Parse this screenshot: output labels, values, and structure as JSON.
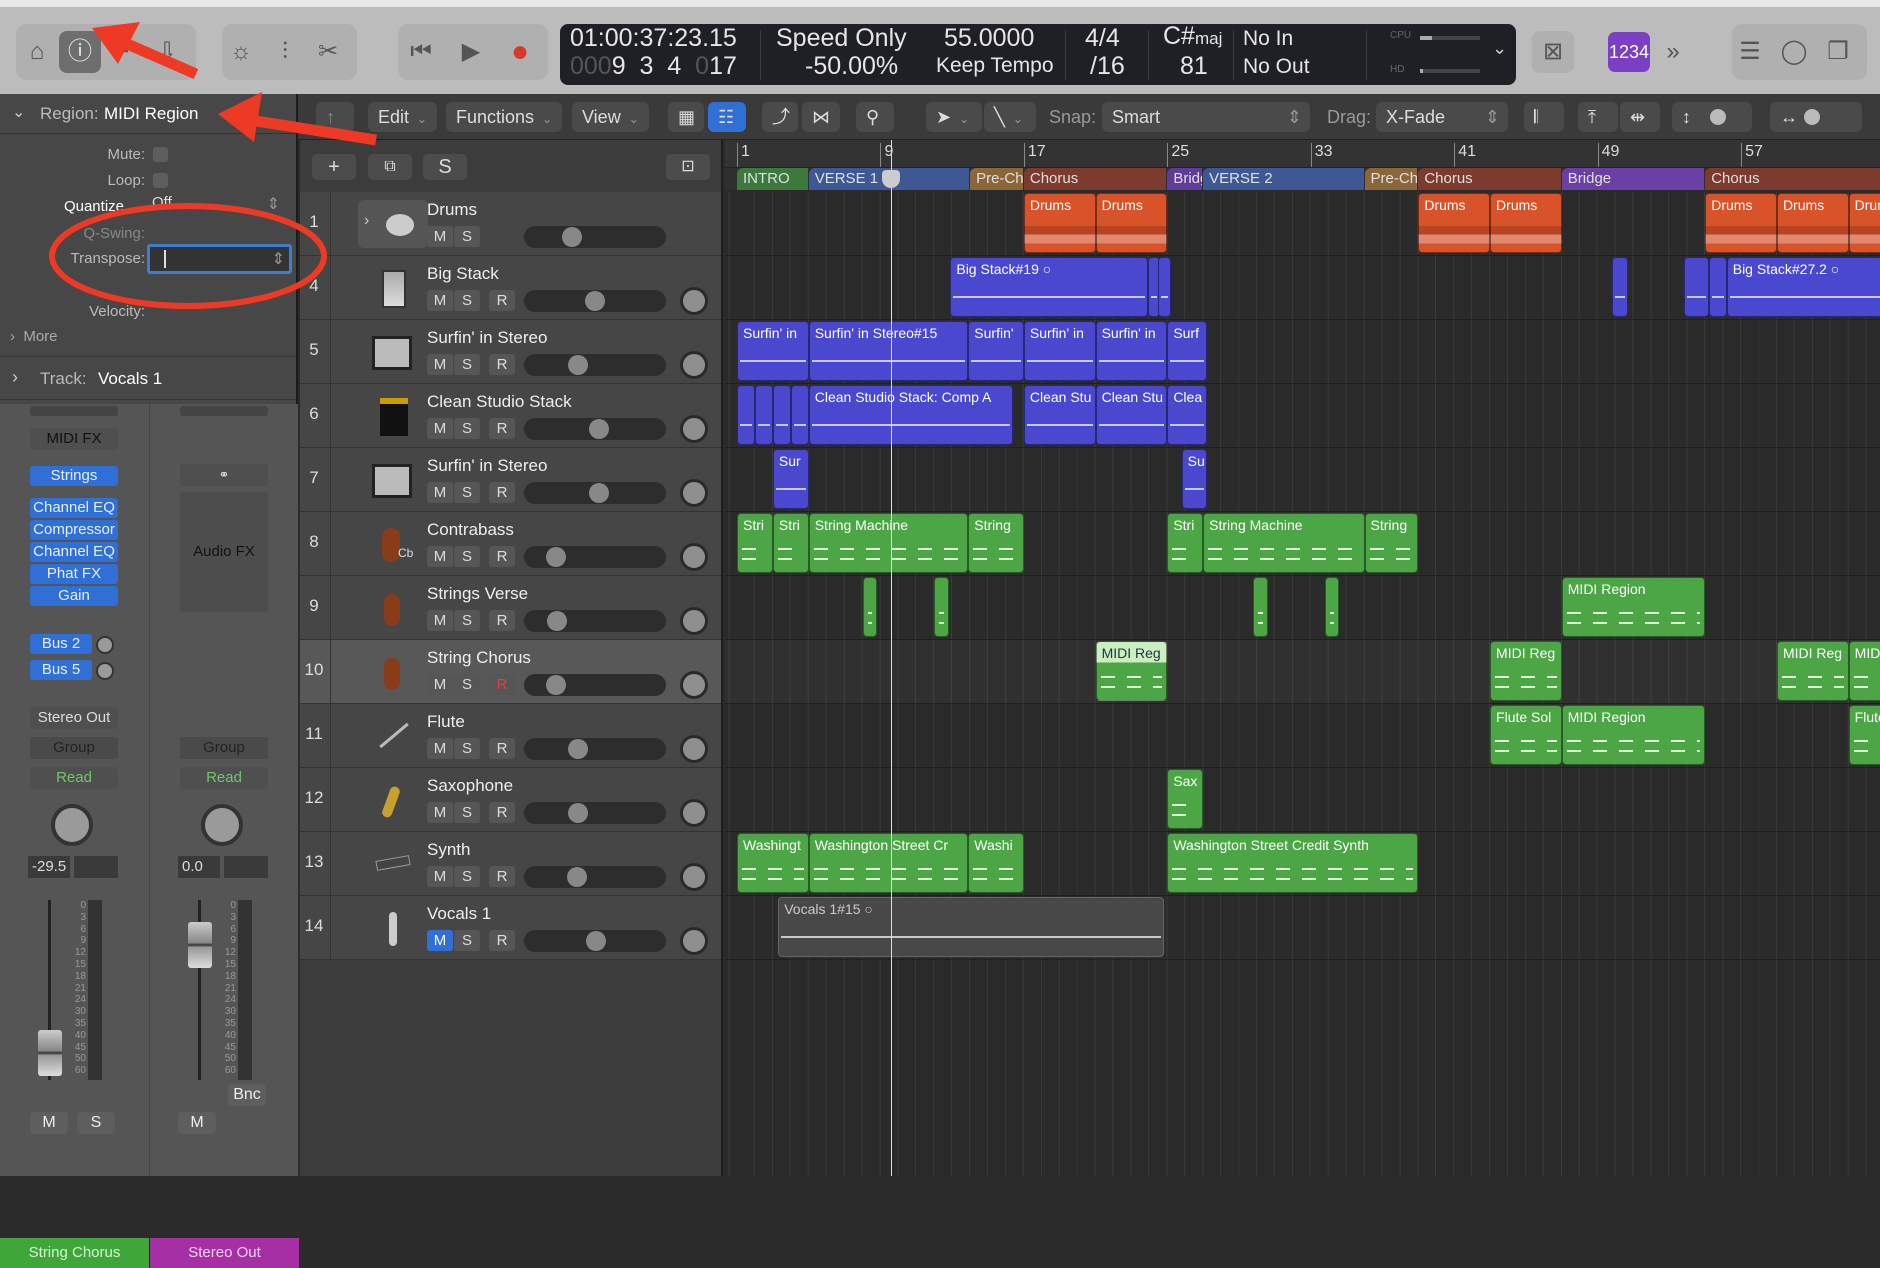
{
  "control_bar": {
    "left_icons": [
      "library-icon",
      "info-icon",
      "help-icon",
      "download-icon"
    ],
    "tool_icons": [
      "smart-controls-icon",
      "mixer-icon",
      "editors-icon"
    ],
    "transport": [
      "rewind-icon",
      "play-icon",
      "record-icon"
    ],
    "lcd": {
      "timecode": "01:00:37:23.15",
      "bar_prefix": "000",
      "bar": "9",
      "beat": "3",
      "division": "4",
      "tick_prefix": "0",
      "tick": "17",
      "speed_mode": "Speed Only",
      "speed_percent": "-50.00%",
      "tempo": "55.0000",
      "tempo_mode": "Keep Tempo",
      "time_signature": "4/4",
      "division_value": "/16",
      "key_root": "C#",
      "key_mode": "maj",
      "key_value": "81",
      "midi_in": "No In",
      "midi_out": "No Out",
      "cpu_label": "CPU",
      "hd_label": "HD",
      "cpu_load": 0.2,
      "hd_load": 0.05
    },
    "count_in_label": "1234",
    "right_icons": [
      "list-editors-icon",
      "loop-browser-icon",
      "browsers-icon"
    ],
    "accent_color": "#7b3fc4"
  },
  "toolbar": {
    "edit": "Edit",
    "functions": "Functions",
    "view": "View",
    "snap_label": "Snap:",
    "snap_value": "Smart",
    "drag_label": "Drag:",
    "drag_value": "X-Fade"
  },
  "inspector": {
    "region_prefix": "Region:",
    "region_name": "MIDI Region",
    "mute": "Mute:",
    "loop": "Loop:",
    "quantize": "Quantize",
    "quantize_value": "Off",
    "qswing": "Q-Swing:",
    "transpose": "Transpose:",
    "transpose_value": "",
    "velocity": "Velocity:",
    "more": "More",
    "track_prefix": "Track:",
    "track_name": "Vocals 1",
    "strip1": {
      "midi_fx": "MIDI FX",
      "instrument": "Strings",
      "plugins": [
        "Channel EQ",
        "Compressor",
        "Channel EQ",
        "Phat FX",
        "Gain"
      ],
      "sends": [
        "Bus 2",
        "Bus 5"
      ],
      "output": "Stereo Out",
      "group": "Group",
      "automation": "Read",
      "volume": "-29.5",
      "mute": "M",
      "solo": "S",
      "name": "String Chorus",
      "color": "#3fa63a"
    },
    "strip2": {
      "audio_fx": "Audio FX",
      "group": "Group",
      "automation": "Read",
      "volume": "0.0",
      "bounce": "Bnc",
      "mute": "M",
      "name": "Stereo Out",
      "color": "#a62fa6"
    },
    "meter_scale": [
      "0",
      "3",
      "6",
      "9",
      "12",
      "15",
      "18",
      "21",
      "24",
      "30",
      "35",
      "40",
      "45",
      "50",
      "60"
    ]
  },
  "track_header": {
    "add": "+",
    "solo": "S"
  },
  "ruler": {
    "labels": [
      1,
      9,
      17,
      25,
      33,
      41,
      49,
      57
    ]
  },
  "playhead_bar": 9.6,
  "markers": [
    {
      "label": "INTRO",
      "start": 1,
      "end": 5,
      "color": "#3b7a3c"
    },
    {
      "label": "VERSE 1",
      "start": 5,
      "end": 14,
      "color": "#3d5894"
    },
    {
      "label": "Pre-Chorus",
      "start": 14,
      "end": 17,
      "color": "#8a6638"
    },
    {
      "label": "Chorus",
      "start": 17,
      "end": 25,
      "color": "#7c3b2c"
    },
    {
      "label": "Bridge",
      "start": 25,
      "end": 27,
      "color": "#5e3d9a"
    },
    {
      "label": "VERSE 2",
      "start": 27,
      "end": 36,
      "color": "#3d5894"
    },
    {
      "label": "Pre-Chorus",
      "start": 36,
      "end": 39,
      "color": "#8a6638"
    },
    {
      "label": "Chorus",
      "start": 39,
      "end": 47,
      "color": "#7c3b2c"
    },
    {
      "label": "Bridge",
      "start": 47,
      "end": 55,
      "color": "#6a3fa6"
    },
    {
      "label": "Chorus",
      "start": 55,
      "end": 66,
      "color": "#7c3b2c"
    }
  ],
  "tracks": [
    {
      "num": "1",
      "name": "Drums",
      "buttons": [
        "M",
        "S"
      ],
      "volume": 0.31,
      "pan": false,
      "icon": "drum-kit-icon",
      "kind": "drums",
      "regions": [
        {
          "label": "Drums",
          "start": 17,
          "end": 21
        },
        {
          "label": "Drums",
          "start": 21,
          "end": 25
        },
        {
          "label": "Drums",
          "start": 39,
          "end": 43
        },
        {
          "label": "Drums",
          "start": 43,
          "end": 47
        },
        {
          "label": "Drums",
          "start": 55,
          "end": 59
        },
        {
          "label": "Drums",
          "start": 59,
          "end": 63
        },
        {
          "label": "Drums",
          "start": 63,
          "end": 67
        }
      ]
    },
    {
      "num": "4",
      "name": "Big Stack",
      "buttons": [
        "M",
        "S",
        "R"
      ],
      "volume": 0.5,
      "pan": true,
      "icon": "amp-stack-icon",
      "kind": "audio",
      "regions": [
        {
          "label": "Big Stack#19 ○",
          "start": 12.9,
          "end": 23.9
        },
        {
          "label": "",
          "start": 23.9,
          "end": 24.5
        },
        {
          "label": "",
          "start": 24.5,
          "end": 25.2
        },
        {
          "label": "",
          "start": 49.8,
          "end": 50.7
        },
        {
          "label": "",
          "start": 53.8,
          "end": 55.2
        },
        {
          "label": "",
          "start": 55.2,
          "end": 56.2
        },
        {
          "label": "Big Stack#27.2 ○",
          "start": 56.2,
          "end": 66
        }
      ]
    },
    {
      "num": "5",
      "name": "Surfin' in Stereo",
      "buttons": [
        "M",
        "S",
        "R"
      ],
      "volume": 0.36,
      "pan": true,
      "icon": "amp-combo-icon",
      "kind": "audio",
      "regions": [
        {
          "label": "Surfin' in",
          "start": 1,
          "end": 5
        },
        {
          "label": "Surfin' in Stereo#15",
          "start": 5,
          "end": 13.9
        },
        {
          "label": "Surfin'",
          "start": 13.9,
          "end": 17
        },
        {
          "label": "Surfin' in",
          "start": 17,
          "end": 21
        },
        {
          "label": "Surfin' in",
          "start": 21,
          "end": 25
        },
        {
          "label": "Surf",
          "start": 25,
          "end": 27.2
        }
      ]
    },
    {
      "num": "6",
      "name": "Clean Studio Stack",
      "buttons": [
        "M",
        "S",
        "R"
      ],
      "volume": 0.53,
      "pan": true,
      "icon": "amp-head-icon",
      "kind": "audio",
      "regions": [
        {
          "label": "",
          "start": 1,
          "end": 2
        },
        {
          "label": "",
          "start": 2,
          "end": 3
        },
        {
          "label": "",
          "start": 3,
          "end": 4
        },
        {
          "label": "",
          "start": 4,
          "end": 5
        },
        {
          "label": "Clean Studio Stack: Comp A",
          "start": 5,
          "end": 16.4
        },
        {
          "label": "Clean Stu",
          "start": 17,
          "end": 21
        },
        {
          "label": "Clean Stu",
          "start": 21,
          "end": 25
        },
        {
          "label": "Clea",
          "start": 25,
          "end": 27.2
        }
      ]
    },
    {
      "num": "7",
      "name": "Surfin' in Stereo",
      "buttons": [
        "M",
        "S",
        "R"
      ],
      "volume": 0.53,
      "pan": true,
      "icon": "amp-combo-icon",
      "kind": "audio",
      "regions": [
        {
          "label": "Sur",
          "start": 3,
          "end": 5
        },
        {
          "label": "Su",
          "start": 25.8,
          "end": 27.2
        }
      ]
    },
    {
      "num": "8",
      "name": "Contrabass",
      "buttons": [
        "M",
        "S",
        "R"
      ],
      "volume": 0.18,
      "pan": true,
      "icon": "contrabass-icon",
      "kind": "midi",
      "regions": [
        {
          "label": "Stri",
          "start": 1,
          "end": 3
        },
        {
          "label": "Stri",
          "start": 3,
          "end": 5
        },
        {
          "label": "String Machine",
          "start": 5,
          "end": 13.9
        },
        {
          "label": "String",
          "start": 13.9,
          "end": 17
        },
        {
          "label": "Stri",
          "start": 25,
          "end": 27
        },
        {
          "label": "String Machine",
          "start": 27,
          "end": 36
        },
        {
          "label": "String",
          "start": 36,
          "end": 39
        }
      ]
    },
    {
      "num": "9",
      "name": "Strings Verse",
      "buttons": [
        "M",
        "S",
        "R"
      ],
      "volume": 0.19,
      "pan": true,
      "icon": "violin-icon",
      "kind": "midi",
      "regions": [
        {
          "label": "",
          "start": 8,
          "end": 8.8
        },
        {
          "label": "",
          "start": 12,
          "end": 12.8
        },
        {
          "label": "",
          "start": 29.8,
          "end": 30.6
        },
        {
          "label": "",
          "start": 33.8,
          "end": 34.6
        },
        {
          "label": "MIDI Region",
          "start": 47,
          "end": 55
        }
      ]
    },
    {
      "num": "10",
      "name": "String Chorus",
      "buttons": [
        "M",
        "S",
        "R"
      ],
      "volume": 0.18,
      "pan": true,
      "icon": "violin-icon",
      "kind": "midi",
      "selected": true,
      "record_armed_color": true,
      "regions": [
        {
          "label": "MIDI Reg",
          "start": 21,
          "end": 25,
          "selected": true
        },
        {
          "label": "MIDI Reg",
          "start": 43,
          "end": 47
        },
        {
          "label": "MIDI Reg",
          "start": 59,
          "end": 63
        },
        {
          "label": "MIDI",
          "start": 63,
          "end": 66
        }
      ]
    },
    {
      "num": "11",
      "name": "Flute",
      "buttons": [
        "M",
        "S",
        "R"
      ],
      "volume": 0.36,
      "pan": true,
      "icon": "flute-icon",
      "kind": "midi",
      "regions": [
        {
          "label": "Flute Sol",
          "start": 43,
          "end": 47
        },
        {
          "label": "MIDI Region",
          "start": 47,
          "end": 55
        },
        {
          "label": "Flute",
          "start": 63,
          "end": 66
        }
      ]
    },
    {
      "num": "12",
      "name": "Saxophone",
      "buttons": [
        "M",
        "S",
        "R"
      ],
      "volume": 0.36,
      "pan": true,
      "icon": "saxophone-icon",
      "kind": "midi",
      "regions": [
        {
          "label": "Sax",
          "start": 25,
          "end": 27
        }
      ]
    },
    {
      "num": "13",
      "name": "Synth",
      "buttons": [
        "M",
        "S",
        "R"
      ],
      "volume": 0.35,
      "pan": true,
      "icon": "synth-icon",
      "kind": "midi",
      "regions": [
        {
          "label": "Washingt",
          "start": 1,
          "end": 5
        },
        {
          "label": "Washington Street Cr",
          "start": 5,
          "end": 13.9
        },
        {
          "label": "Washi",
          "start": 13.9,
          "end": 17
        },
        {
          "label": "Washington Street Credit Synth",
          "start": 25,
          "end": 39
        }
      ]
    },
    {
      "num": "14",
      "name": "Vocals 1",
      "buttons": [
        "M",
        "S",
        "R"
      ],
      "volume": 0.51,
      "pan": true,
      "icon": "microphone-icon",
      "kind": "vocal",
      "monitor_on": true,
      "regions": [
        {
          "label": "Vocals 1#15 ○",
          "start": 3.3,
          "end": 24.8
        }
      ]
    }
  ]
}
